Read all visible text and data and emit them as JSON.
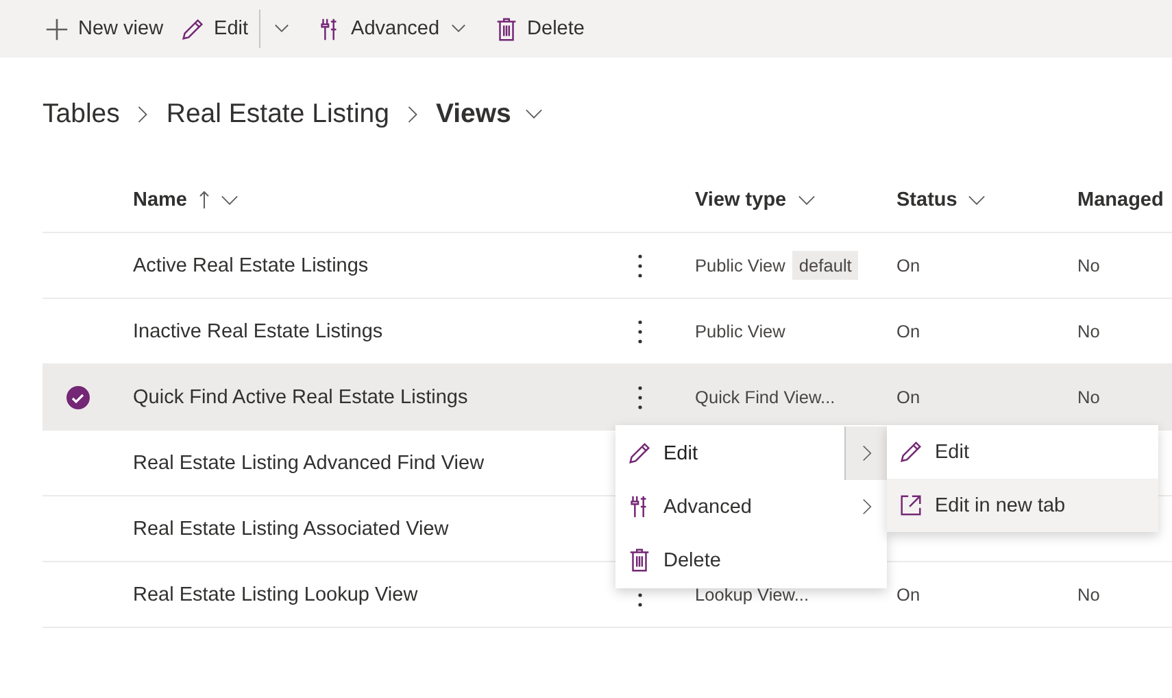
{
  "toolbar": [
    {
      "kind": "add",
      "label": "New view",
      "dropdown": false
    },
    {
      "kind": "edit",
      "label": "Edit",
      "dropdown": true
    },
    {
      "kind": "advanced",
      "label": "Advanced",
      "dropdown": true
    },
    {
      "kind": "delete",
      "label": "Delete",
      "dropdown": false
    }
  ],
  "breadcrumb": [
    "Tables",
    "Real Estate Listing",
    "Views"
  ],
  "table": {
    "columns": [
      {
        "label": "Name",
        "sorted": true
      },
      {
        "label": "View type",
        "sorted": false
      },
      {
        "label": "Status",
        "sorted": false
      },
      {
        "label": "Managed",
        "sorted": false
      }
    ],
    "rows": [
      {
        "name": "Active Real Estate Listings",
        "view_type": "Public View",
        "badge": "default",
        "status": "On",
        "managed": "No",
        "selected": false
      },
      {
        "name": "Inactive Real Estate Listings",
        "view_type": "Public View",
        "status": "On",
        "managed": "No",
        "selected": false
      },
      {
        "name": "Quick Find Active Real Estate Listings",
        "view_type": "Quick Find View...",
        "status": "On",
        "managed": "No",
        "selected": true
      },
      {
        "name": "Real Estate Listing Advanced Find View",
        "selected": false
      },
      {
        "name": "Real Estate Listing Associated View",
        "selected": false
      },
      {
        "name": "Real Estate Listing Lookup View",
        "view_type": "Lookup View...",
        "status": "On",
        "managed": "No",
        "selected": false
      }
    ]
  },
  "context_menu": {
    "items": [
      {
        "kind": "edit",
        "label": "Edit",
        "submenu": true,
        "expanded": true
      },
      {
        "kind": "advanced",
        "label": "Advanced",
        "submenu": true,
        "expanded": false
      },
      {
        "kind": "delete",
        "label": "Delete",
        "submenu": false,
        "expanded": false
      }
    ],
    "submenu": [
      {
        "kind": "edit",
        "label": "Edit",
        "selected": false
      },
      {
        "kind": "open-new",
        "label": "Edit in new tab",
        "selected": true
      }
    ]
  }
}
